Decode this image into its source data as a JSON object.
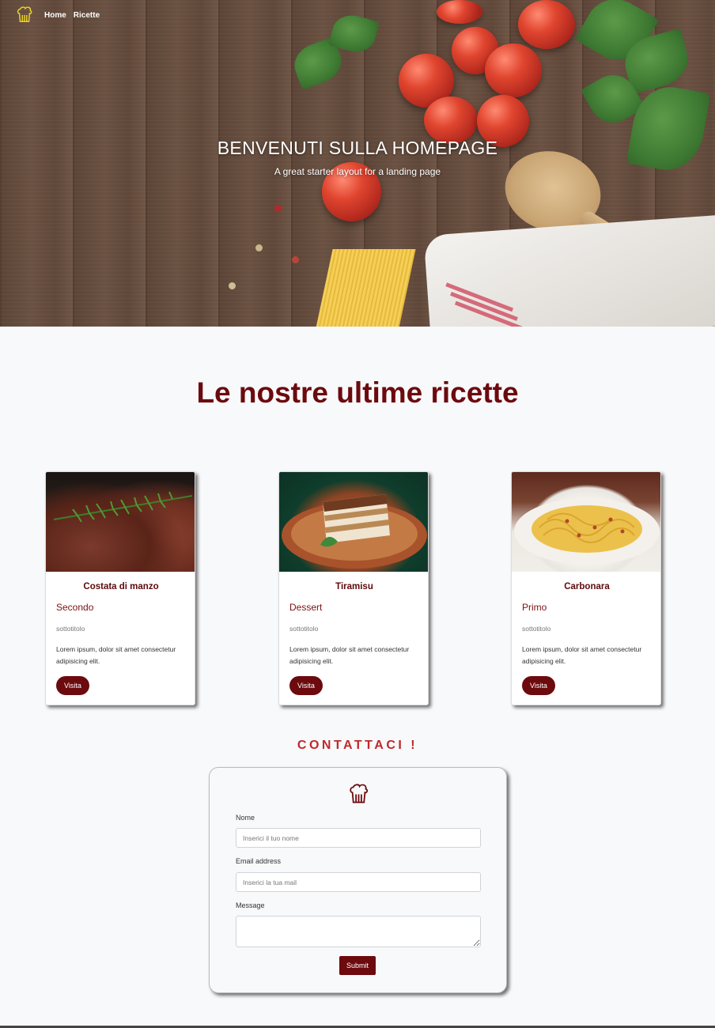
{
  "nav": {
    "logo_icon": "chef-hat-icon",
    "links": [
      "Home",
      "Ricette"
    ]
  },
  "hero": {
    "title": "BENVENUTI SULLA HOMEPAGE",
    "subtitle": "A great starter layout for a landing page"
  },
  "recipes": {
    "heading": "Le nostre ultime ricette",
    "cards": [
      {
        "title": "Costata di manzo",
        "category": "Secondo",
        "subtitle": "sottotitolo",
        "text": "Lorem ipsum, dolor sit amet consectetur adipisicing elit.",
        "button": "Visita"
      },
      {
        "title": "Tiramisu",
        "category": "Dessert",
        "subtitle": "sottotitolo",
        "text": "Lorem ipsum, dolor sit amet consectetur adipisicing elit.",
        "button": "Visita"
      },
      {
        "title": "Carbonara",
        "category": "Primo",
        "subtitle": "sottotitolo",
        "text": "Lorem ipsum, dolor sit amet consectetur adipisicing elit.",
        "button": "Visita"
      }
    ]
  },
  "contact": {
    "heading": "CONTATTACI !",
    "logo_icon": "chef-hat-icon",
    "name_label": "Nome",
    "name_placeholder": "Inserici il tuo nome",
    "email_label": "Email address",
    "email_placeholder": "Inserici la tua mail",
    "message_label": "Message",
    "submit_label": "Submit"
  },
  "colors": {
    "accent": "#6c0a0e",
    "contact_heading": "#c0292c",
    "logo_yellow": "#e8d32a"
  }
}
